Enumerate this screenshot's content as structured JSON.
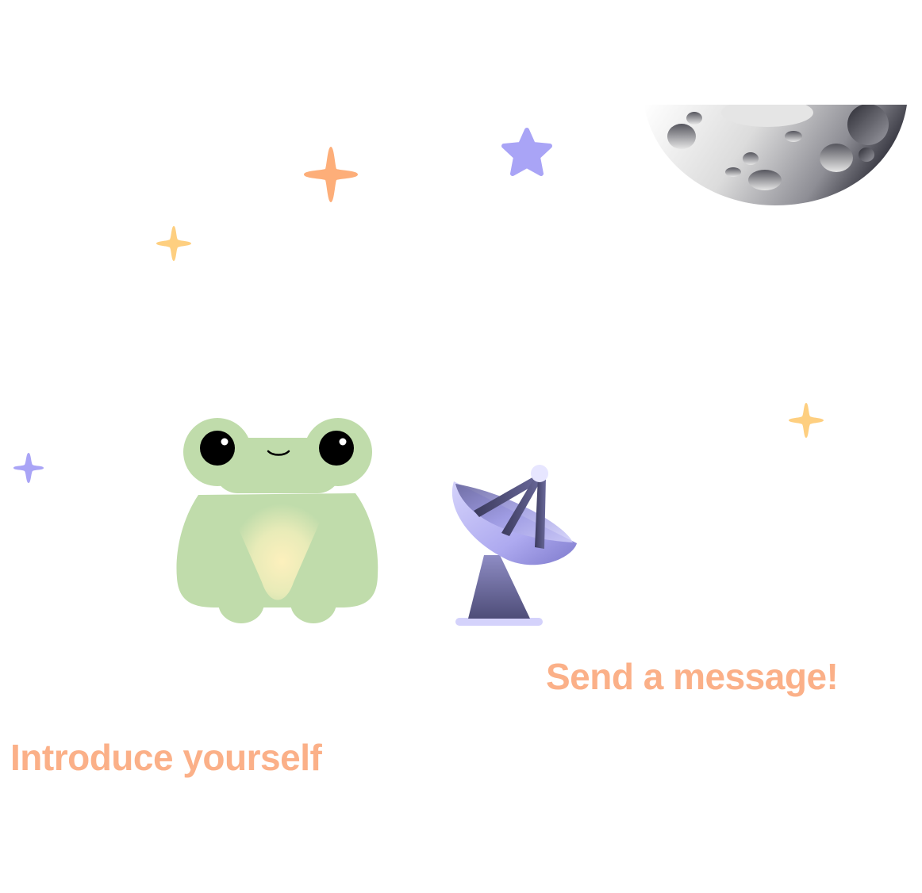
{
  "captions": {
    "send_message": "Send a message!",
    "introduce_yourself": "Introduce yourself"
  },
  "colors": {
    "caption": "#fbb088",
    "star_orange": "#fdae79",
    "star_yellow": "#fecf80",
    "star_purple": "#a9a4f6",
    "frog_body": "#c0dcab",
    "frog_belly": "#fdf0bd",
    "antenna_dish": "#b8b5f2",
    "antenna_base": "#5b5a87",
    "moon_light": "#f2f2f2",
    "moon_dark": "#3a3a44"
  },
  "icons": [
    "sparkle-star-icon",
    "five-point-star-icon",
    "moon-icon",
    "frog-illustration",
    "satellite-dish-icon"
  ]
}
